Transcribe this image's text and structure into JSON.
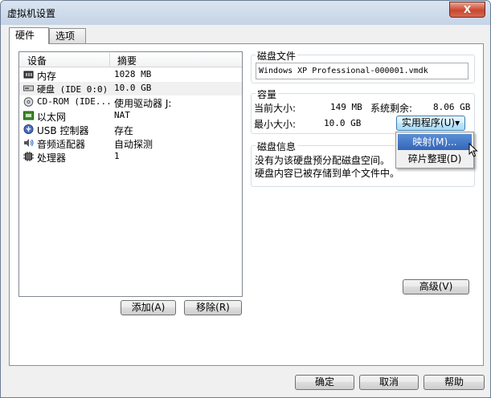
{
  "window": {
    "title": "虚拟机设置",
    "close_label": "X"
  },
  "tabs": [
    {
      "label": "硬件"
    },
    {
      "label": "选项"
    }
  ],
  "device_list": {
    "columns": [
      "设备",
      "摘要"
    ],
    "rows": [
      {
        "device": "内存",
        "summary": "1028 MB",
        "icon": "memory-icon"
      },
      {
        "device": "硬盘 (IDE 0:0)",
        "summary": "10.0 GB",
        "icon": "hard-disk-icon"
      },
      {
        "device": "CD-ROM (IDE...",
        "summary": "使用驱动器 J:",
        "icon": "cdrom-icon"
      },
      {
        "device": "以太网",
        "summary": "NAT",
        "icon": "network-icon"
      },
      {
        "device": "USB 控制器",
        "summary": "存在",
        "icon": "usb-icon"
      },
      {
        "device": "音频适配器",
        "summary": "自动探测",
        "icon": "audio-icon"
      },
      {
        "device": "处理器",
        "summary": "1",
        "icon": "cpu-icon"
      }
    ],
    "add_label": "添加(A)",
    "remove_label": "移除(R)"
  },
  "disk_file": {
    "title": "磁盘文件",
    "value": "Windows XP Professional-000001.vmdk"
  },
  "capacity": {
    "title": "容量",
    "current_label": "当前大小:",
    "current_value": "149 MB",
    "free_label": "系统剩余:",
    "free_value": "8.06 GB",
    "max_label": "最小大小:",
    "max_value": "10.0 GB",
    "utilities_label": "实用程序(U)"
  },
  "disk_info": {
    "title": "磁盘信息",
    "line1": "没有为该硬盘预分配磁盘空间。",
    "line2": "硬盘内容已被存储到单个文件中。"
  },
  "utilities_menu": [
    {
      "label": "映射(M)..."
    },
    {
      "label": "碎片整理(D)"
    }
  ],
  "advanced_label": "高级(V)",
  "footer": {
    "ok_label": "确定",
    "cancel_label": "取消",
    "help_label": "帮助"
  }
}
